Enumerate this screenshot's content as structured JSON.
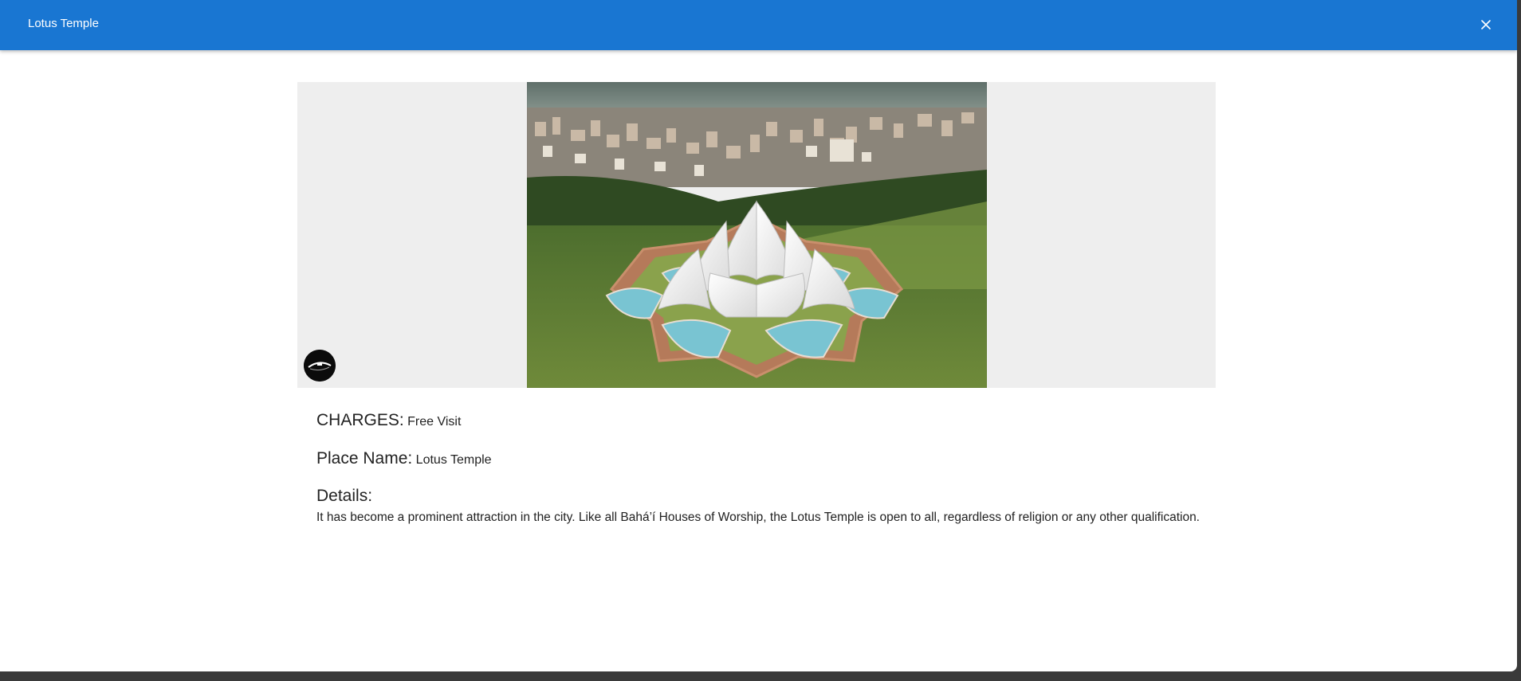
{
  "appbar": {
    "title": "Lotus Temple",
    "background_color": "#1976d2",
    "close_icon": "close-icon"
  },
  "media": {
    "image_subject": "aerial view of the Lotus Temple with surrounding city",
    "logo_icon": "brand-logo-icon"
  },
  "info": {
    "charges_label": "CHARGES:",
    "charges_value": "Free Visit",
    "place_label": "Place Name:",
    "place_value": "Lotus Temple",
    "details_label": "Details:",
    "details_text": "It has become a prominent attraction in the city. Like all Bahá’í Houses of Worship, the Lotus Temple is open to all, regardless of religion or any other qualification."
  }
}
